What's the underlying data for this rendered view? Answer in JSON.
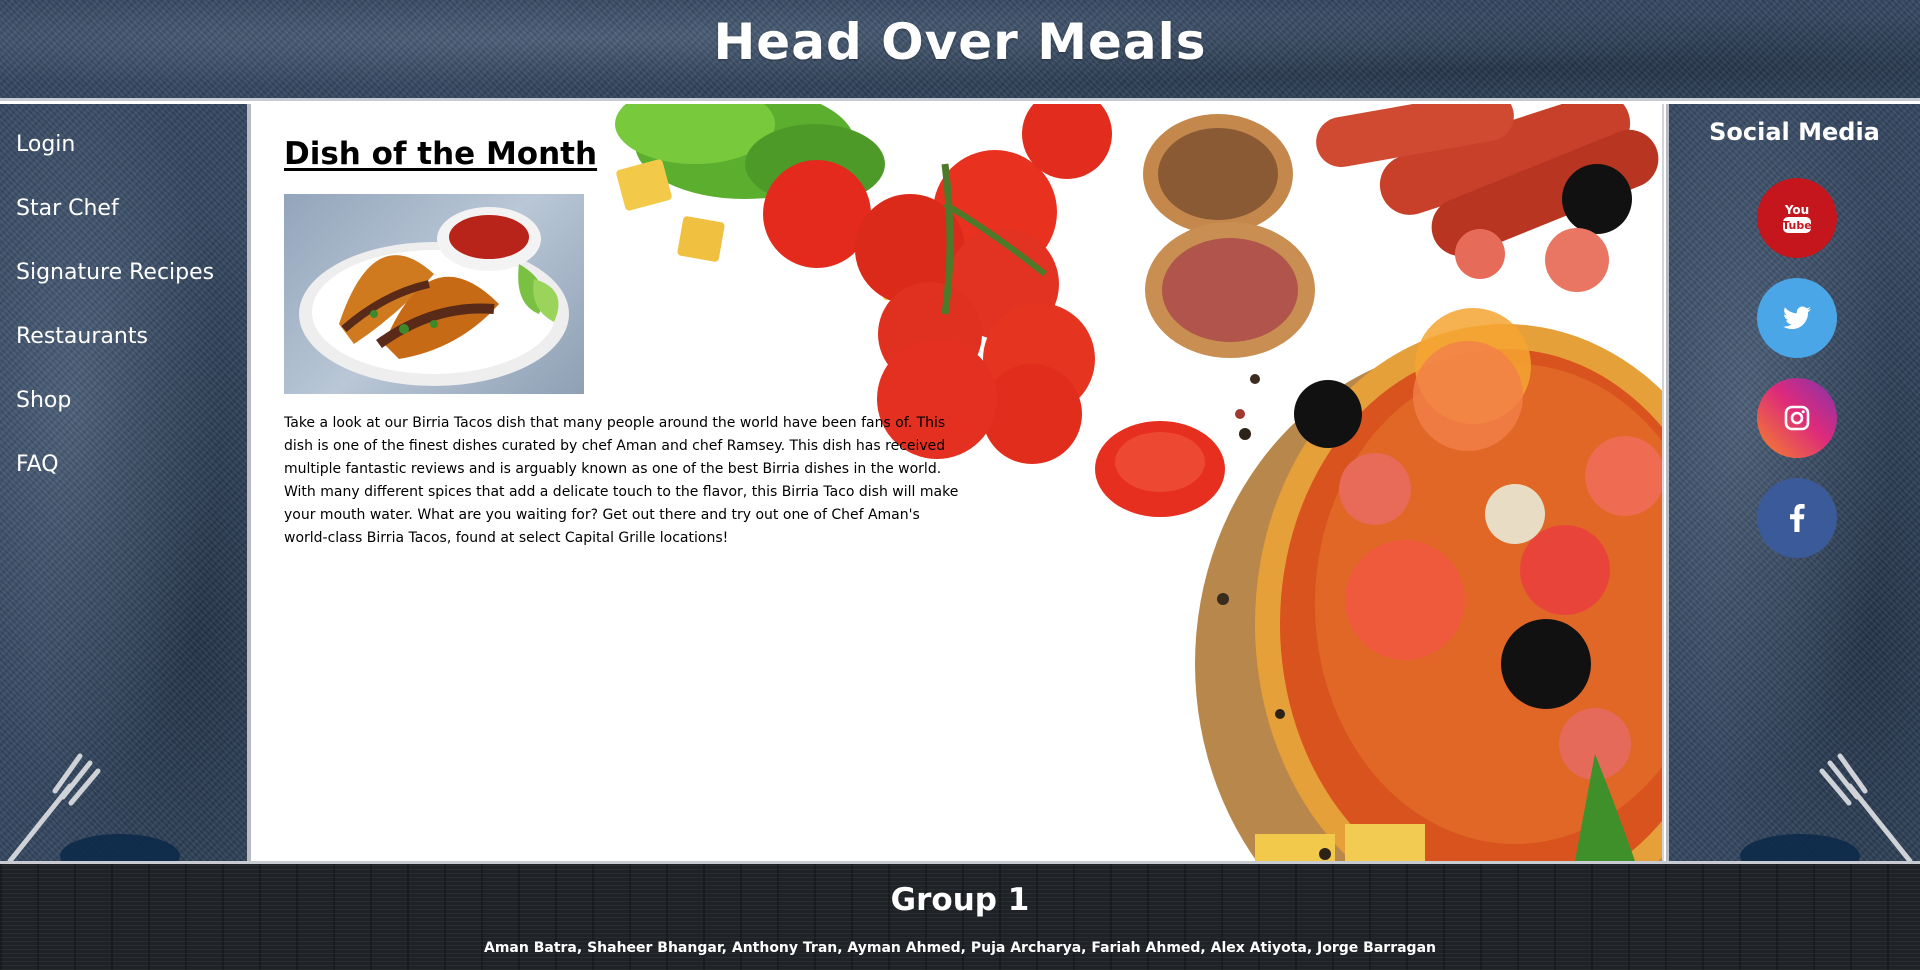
{
  "header": {
    "title": "Head Over Meals"
  },
  "nav": {
    "items": [
      {
        "label": "Login"
      },
      {
        "label": "Star Chef"
      },
      {
        "label": "Signature Recipes"
      },
      {
        "label": "Restaurants"
      },
      {
        "label": "Shop"
      },
      {
        "label": "FAQ"
      }
    ]
  },
  "main": {
    "heading": "Dish of the Month",
    "body": "Take a look at our Birria Tacos dish that many people around the world have been fans of. This dish is one of the finest dishes curated by chef Aman and chef Ramsey. This dish has received multiple fantastic reviews and is arguably known as one of the best Birria dishes in the world. With many different spices that add a delicate touch to the flavor, this Birria Taco dish will make your mouth water. What are you waiting for? Get out there and try out one of Chef Aman's world-class Birria Tacos, found at select Capital Grille locations!"
  },
  "social": {
    "title": "Social Media",
    "items": [
      {
        "icon": "youtube-icon",
        "color": "#c4161c"
      },
      {
        "icon": "twitter-icon",
        "color": "#4aa6e6"
      },
      {
        "icon": "instagram-icon",
        "color": "#d6306d"
      },
      {
        "icon": "facebook-icon",
        "color": "#3b5a9a"
      }
    ],
    "youtube_text_top": "You",
    "youtube_text_bottom": "Tube"
  },
  "footer": {
    "title": "Group 1",
    "names": "Aman Batra, Shaheer Bhangar, Anthony Tran, Ayman Ahmed, Puja Archarya, Fariah Ahmed, Alex Atiyota, Jorge Barragan"
  }
}
